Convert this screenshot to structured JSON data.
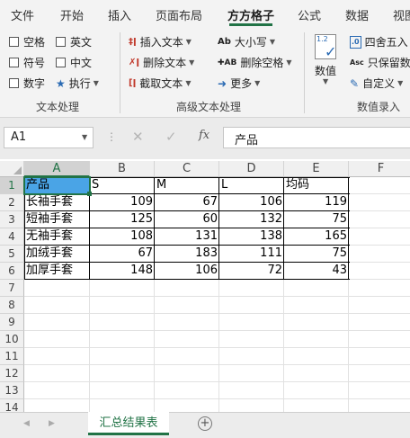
{
  "ribbon_tabs": [
    "文件",
    "开始",
    "插入",
    "页面布局",
    "方方格子",
    "公式",
    "数据",
    "视图"
  ],
  "active_tab": "方方格子",
  "ribbon": {
    "text_group": {
      "checkboxes": [
        "空格",
        "英文",
        "符号",
        "中文",
        "数字"
      ],
      "execute": "执行",
      "label": "文本处理"
    },
    "advanced_group": {
      "insert_text": "插入文本",
      "delete_text": "删除文本",
      "extract_text": "截取文本",
      "case": "大小写",
      "delete_space": "删除空格",
      "more": "更多",
      "label": "高级文本处理"
    },
    "number_group": {
      "value": "数值",
      "round": "四舍五入",
      "keep_value": "只保留数",
      "custom": "自定义",
      "label": "数值录入"
    }
  },
  "formula_bar": {
    "name_box": "A1",
    "fx": "fx",
    "formula": "产品"
  },
  "grid": {
    "columns": [
      "A",
      "B",
      "C",
      "D",
      "E",
      "F"
    ],
    "rows": [
      "1",
      "2",
      "3",
      "4",
      "5",
      "6",
      "7",
      "8",
      "9",
      "10",
      "11",
      "12",
      "13",
      "14"
    ],
    "header": [
      "产品",
      "S",
      "M",
      "L",
      "均码"
    ],
    "data": [
      [
        "长袖手套",
        "109",
        "67",
        "106",
        "119"
      ],
      [
        "短袖手套",
        "125",
        "60",
        "132",
        "75"
      ],
      [
        "无袖手套",
        "108",
        "131",
        "138",
        "165"
      ],
      [
        "加绒手套",
        "67",
        "183",
        "111",
        "75"
      ],
      [
        "加厚手套",
        "148",
        "106",
        "72",
        "43"
      ]
    ]
  },
  "sheet_tabs": [
    "汇总结果表"
  ],
  "colors": {
    "accent": "#217346",
    "selection": "#4aa4e6"
  }
}
